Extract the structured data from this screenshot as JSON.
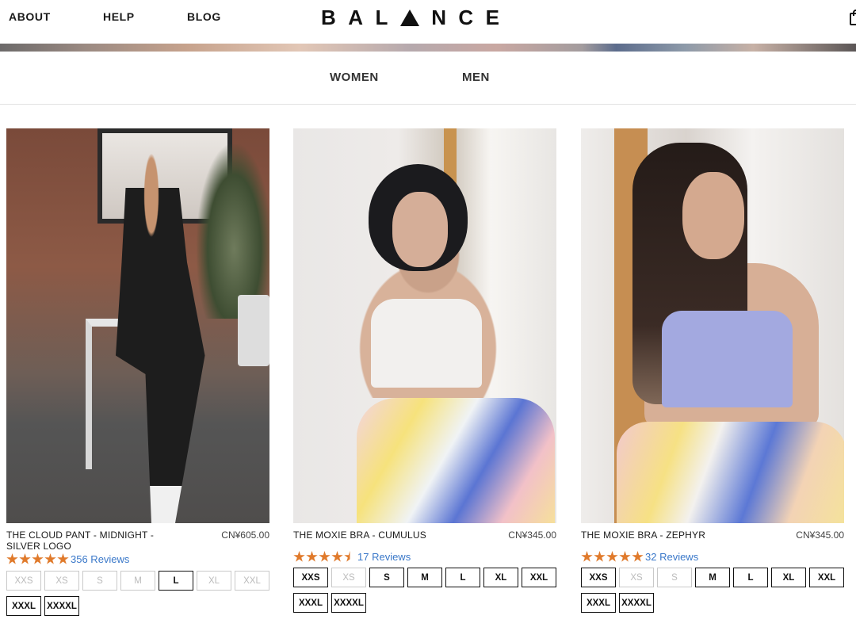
{
  "header": {
    "nav": [
      "ABOUT",
      "HELP",
      "BLOG"
    ],
    "logo": [
      "B",
      "A",
      "L",
      "",
      "N",
      "C",
      "E"
    ]
  },
  "category_nav": {
    "women": "WOMEN",
    "men": "MEN"
  },
  "products": [
    {
      "title": "THE CLOUD PANT - MIDNIGHT - SILVER LOGO",
      "price": "CN¥605.00",
      "rating": 5,
      "reviews": "356 Reviews",
      "sizes": [
        {
          "label": "XXS",
          "available": false
        },
        {
          "label": "XS",
          "available": false
        },
        {
          "label": "S",
          "available": false
        },
        {
          "label": "M",
          "available": false
        },
        {
          "label": "L",
          "available": true
        },
        {
          "label": "XL",
          "available": false
        },
        {
          "label": "XXL",
          "available": false
        },
        {
          "label": "XXXL",
          "available": true
        },
        {
          "label": "XXXXL",
          "available": true
        }
      ]
    },
    {
      "title": "THE MOXIE BRA - CUMULUS",
      "price": "CN¥345.00",
      "rating": 4.5,
      "reviews": "17 Reviews",
      "sizes": [
        {
          "label": "XXS",
          "available": true
        },
        {
          "label": "XS",
          "available": false
        },
        {
          "label": "S",
          "available": true
        },
        {
          "label": "M",
          "available": true
        },
        {
          "label": "L",
          "available": true
        },
        {
          "label": "XL",
          "available": true
        },
        {
          "label": "XXL",
          "available": true
        },
        {
          "label": "XXXL",
          "available": true
        },
        {
          "label": "XXXXL",
          "available": true
        }
      ]
    },
    {
      "title": "THE MOXIE BRA - ZEPHYR",
      "price": "CN¥345.00",
      "rating": 5,
      "reviews": "32 Reviews",
      "sizes": [
        {
          "label": "XXS",
          "available": true
        },
        {
          "label": "XS",
          "available": false
        },
        {
          "label": "S",
          "available": false
        },
        {
          "label": "M",
          "available": true
        },
        {
          "label": "L",
          "available": true
        },
        {
          "label": "XL",
          "available": true
        },
        {
          "label": "XXL",
          "available": true
        },
        {
          "label": "XXXL",
          "available": true
        },
        {
          "label": "XXXXL",
          "available": true
        }
      ]
    }
  ],
  "colors": {
    "star": "#e07a2b",
    "review_link": "#3a78c9"
  }
}
